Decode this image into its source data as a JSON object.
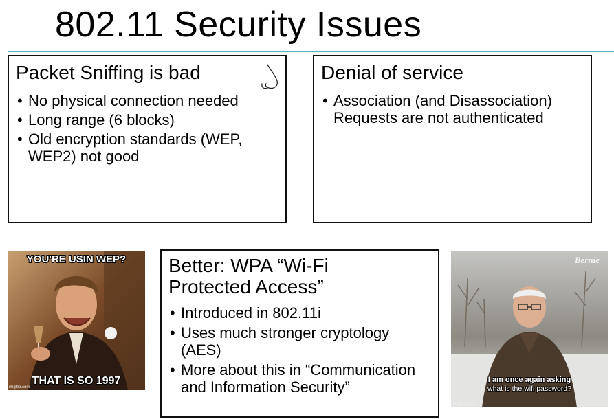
{
  "slide": {
    "title": "802.11 Security Issues"
  },
  "boxes": {
    "sniffing": {
      "heading": "Packet Sniffing is bad",
      "bullets": [
        "No physical connection needed",
        "Long range (6 blocks)",
        "Old encryption standards (WEP, WEP2) not good"
      ]
    },
    "dos": {
      "heading": "Denial of service",
      "bullets": [
        "Association (and Disassociation) Requests are not authenticated"
      ]
    },
    "wpa": {
      "heading": "Better: WPA “Wi-Fi Protected Access”",
      "bullets": [
        "Introduced in 802.11i",
        "Uses much stronger cryptology (AES)",
        "More about this in “Communication and Information Security”"
      ]
    }
  },
  "memes": {
    "left": {
      "top_text": "YOU'RE USIN WEP?",
      "bottom_text": "THAT IS SO 1997",
      "watermark": "imgflip.com"
    },
    "right": {
      "logo": "Bernie",
      "line1": "I am once again asking",
      "line2": "what is the wifi password?",
      "watermark": "imgflip.com"
    }
  },
  "colors": {
    "title_rule": "#4fb7c2",
    "box_border": "#111111"
  }
}
